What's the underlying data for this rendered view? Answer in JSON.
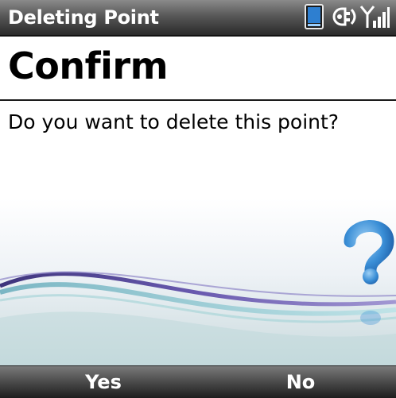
{
  "titlebar": {
    "title": "Deleting Point",
    "icons": [
      "device-status-icon",
      "connectivity-icon",
      "signal-strength-icon"
    ]
  },
  "dialog": {
    "heading": "Confirm",
    "message": "Do you want to delete this point?",
    "icon": "question-mark-icon"
  },
  "softkeys": {
    "left_label": "Yes",
    "right_label": "No"
  },
  "colors": {
    "bar_dark": "#2a2a2a",
    "bar_light": "#8a8a8a",
    "accent_blue": "#3a8ed6",
    "wave_purple": "#3b2a86",
    "wave_teal": "#7fc8c8"
  }
}
